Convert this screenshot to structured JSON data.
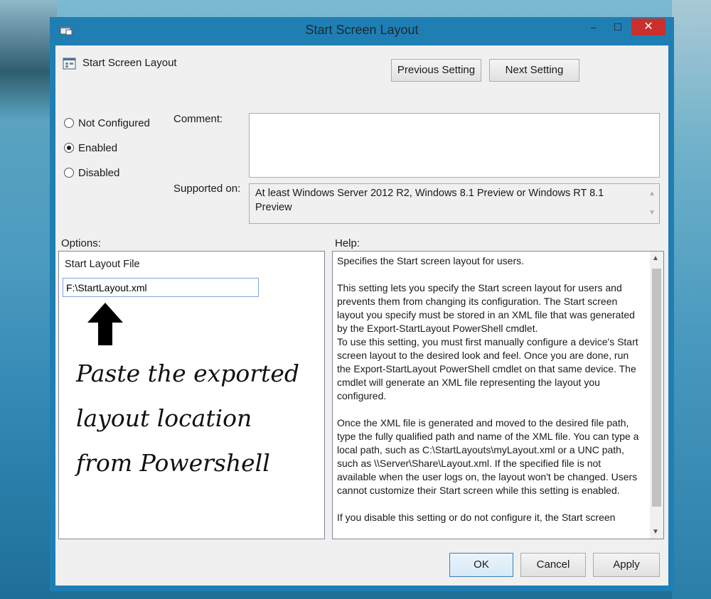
{
  "window": {
    "title": "Start Screen Layout",
    "close_glyph": "✕",
    "min_glyph": "–",
    "max_glyph": "☐"
  },
  "header": {
    "setting_name": "Start Screen Layout"
  },
  "nav": {
    "previous": "Previous Setting",
    "next": "Next Setting"
  },
  "state": {
    "options": [
      {
        "label": "Not Configured",
        "selected": false
      },
      {
        "label": "Enabled",
        "selected": true
      },
      {
        "label": "Disabled",
        "selected": false
      }
    ]
  },
  "labels": {
    "comment": "Comment:",
    "supported_on": "Supported on:",
    "options": "Options:",
    "help": "Help:"
  },
  "comment": {
    "value": ""
  },
  "supported_on": {
    "value": "At least Windows Server 2012 R2, Windows 8.1 Preview or Windows RT 8.1 Preview"
  },
  "options_panel": {
    "file_label": "Start Layout File",
    "file_value": "F:\\StartLayout.xml",
    "annotation": [
      "Paste the exported",
      "layout location",
      "from Powershell"
    ]
  },
  "help": {
    "p1": "Specifies the Start screen layout for users.",
    "p2": "This setting lets you specify the Start screen layout for users and prevents them from changing its configuration. The Start screen layout you specify must be stored in an XML file that was generated by the Export-StartLayout PowerShell cmdlet.",
    "p3": "To use this setting, you must first manually configure a device's Start screen layout to the desired look and feel. Once you are done, run the Export-StartLayout PowerShell cmdlet on that same device. The cmdlet will generate an XML file representing the layout you configured.",
    "p4": "Once the XML file is generated and moved to the desired file path, type the fully qualified path and name of the XML file. You can type a local path, such as C:\\StartLayouts\\myLayout.xml or a UNC path, such as \\\\Server\\Share\\Layout.xml. If the specified file is not available when the user logs on, the layout won't be changed. Users cannot customize their Start screen while this setting is enabled.",
    "p5": "If you disable this setting or do not configure it, the Start screen"
  },
  "footer": {
    "ok": "OK",
    "cancel": "Cancel",
    "apply": "Apply"
  },
  "colors": {
    "titlebar": "#1f7fb3",
    "close": "#c9302c",
    "client": "#f0f0f0"
  }
}
